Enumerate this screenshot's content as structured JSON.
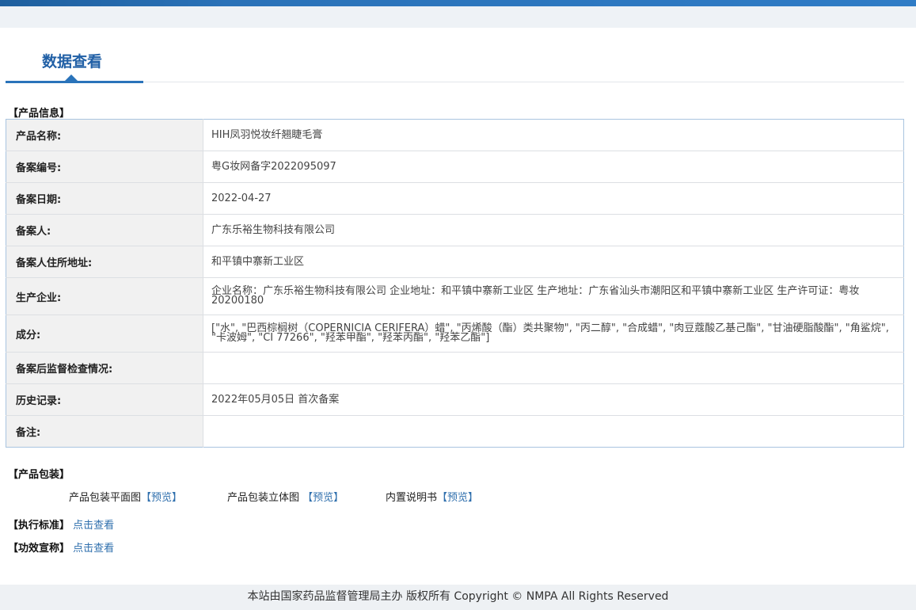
{
  "header": {
    "tab_title": "数据查看"
  },
  "product_info": {
    "section_title": "【产品信息】",
    "rows": [
      {
        "label": "产品名称:",
        "value": "HIH凤羽悦妆纤翘睫毛膏"
      },
      {
        "label": "备案编号:",
        "value": "粤G妆网备字2022095097"
      },
      {
        "label": "备案日期:",
        "value": "2022-04-27"
      },
      {
        "label": "备案人:",
        "value": "广东乐裕生物科技有限公司"
      },
      {
        "label": "备案人住所地址:",
        "value": "和平镇中寨新工业区"
      },
      {
        "label": "生产企业:",
        "value": "企业名称：广东乐裕生物科技有限公司 企业地址：和平镇中寨新工业区 生产地址：广东省汕头市潮阳区和平镇中寨新工业区 生产许可证：粤妆20200180"
      },
      {
        "label": "成分:",
        "value": "[\"水\", \"巴西棕榈树（COPERNICIA CERIFERA）蜡\", \"丙烯酸（酯）类共聚物\", \"丙二醇\", \"合成蜡\", \"肉豆蔻酸乙基己酯\", \"甘油硬脂酸酯\", \"角鲨烷\", \"卡波姆\", \"CI 77266\", \"羟苯甲酯\", \"羟苯丙酯\", \"羟苯乙酯\"]"
      },
      {
        "label": "备案后监督检查情况:",
        "value": ""
      },
      {
        "label": "历史记录:",
        "value": "2022年05月05日 首次备案"
      },
      {
        "label": "备注:",
        "value": ""
      }
    ]
  },
  "packaging": {
    "section_title": "【产品包装】",
    "items": [
      {
        "label": "产品包装平面图",
        "link": "【预览】"
      },
      {
        "label": "产品包装立体图 ",
        "link": "【预览】"
      },
      {
        "label": "内置说明书",
        "link": "【预览】"
      }
    ]
  },
  "standard": {
    "label": "【执行标准】",
    "link": "点击查看"
  },
  "efficacy": {
    "label": "【功效宣称】",
    "link": "点击查看"
  },
  "footer": {
    "text": "本站由国家药品监督管理局主办 版权所有 Copyright © NMPA All Rights Reserved"
  }
}
